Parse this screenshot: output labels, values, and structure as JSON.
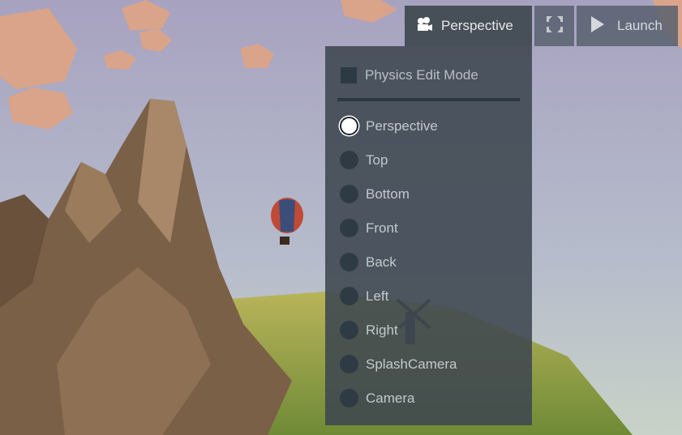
{
  "toolbar": {
    "camera_label": "Perspective",
    "camera_icon": "video-camera-icon",
    "fullscreen_icon": "expand-icon",
    "launch_label": "Launch",
    "launch_icon": "play-icon"
  },
  "camera_menu": {
    "physics_edit_mode": {
      "label": "Physics Edit Mode",
      "checked": false
    },
    "selected": "Perspective",
    "options": [
      "Perspective",
      "Top",
      "Bottom",
      "Front",
      "Back",
      "Left",
      "Right",
      "SplashCamera",
      "Camera"
    ]
  },
  "colors": {
    "panel": "#474f58",
    "button": "#58606e"
  }
}
